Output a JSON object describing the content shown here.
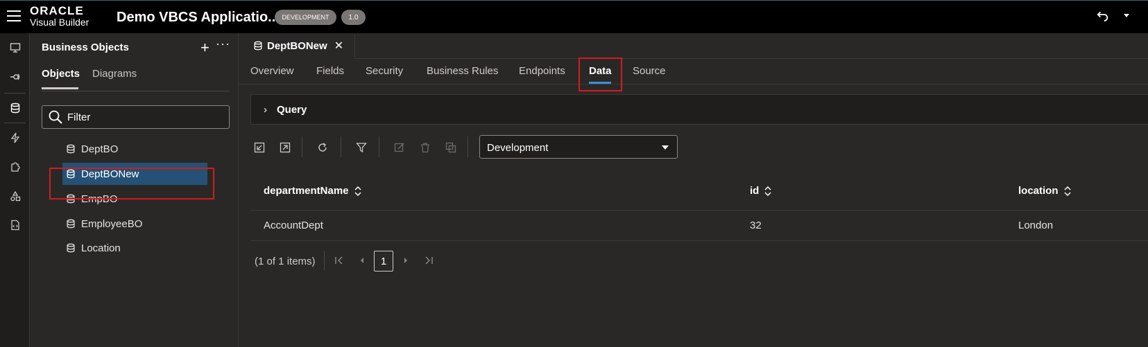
{
  "header": {
    "logo_top": "ORACLE",
    "logo_bottom": "Visual Builder",
    "app_title": "Demo VBCS Applicatio...",
    "env_badge": "DEVELOPMENT",
    "version_badge": "1.0"
  },
  "rail": {
    "items": [
      "monitor-icon",
      "service-icon",
      "database-icon",
      "lightning-icon",
      "puzzle-icon",
      "components-icon",
      "source-icon"
    ]
  },
  "left_panel": {
    "title": "Business Objects",
    "tabs": [
      "Objects",
      "Diagrams"
    ],
    "filter_label": "Filter",
    "items": [
      "DeptBO",
      "DeptBONew",
      "EmpBO",
      "EmployeeBO",
      "Location"
    ],
    "selected_item": "DeptBONew"
  },
  "editor": {
    "file_tab": "DeptBONew",
    "subtabs": [
      "Overview",
      "Fields",
      "Security",
      "Business Rules",
      "Endpoints",
      "Data",
      "Source"
    ],
    "active_subtab": "Data",
    "query_label": "Query",
    "environment_select": "Development",
    "table": {
      "columns": [
        "departmentName",
        "id",
        "location"
      ],
      "rows": [
        [
          "AccountDept",
          "32",
          "London"
        ]
      ]
    },
    "pager": {
      "summary": "(1 of 1 items)",
      "current_page": "1"
    }
  },
  "colors": {
    "accent": "#3f8fd6",
    "selection": "#245175",
    "highlight_box": "#d21c1c"
  }
}
